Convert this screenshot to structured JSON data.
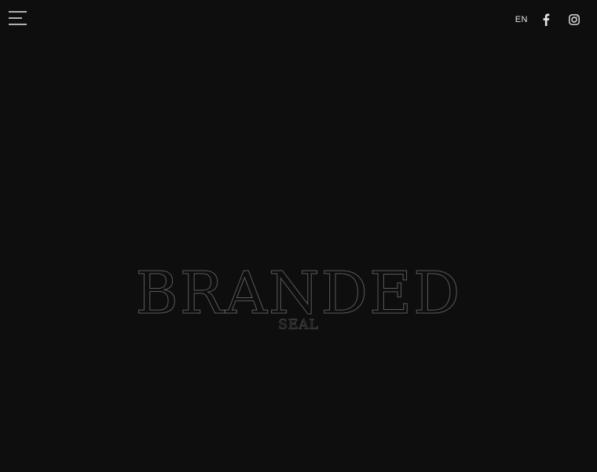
{
  "header": {
    "language": "EN",
    "icons": {
      "menu": "hamburger-menu-icon",
      "facebook": "facebook-icon",
      "instagram": "instagram-icon"
    }
  },
  "logo": {
    "wordmark": "BRANDED",
    "subtitle": "SEAL"
  },
  "colors": {
    "background": "#0e0e0e",
    "foreground": "#e6e6e6",
    "logo_outline": "#5a5a5a"
  }
}
